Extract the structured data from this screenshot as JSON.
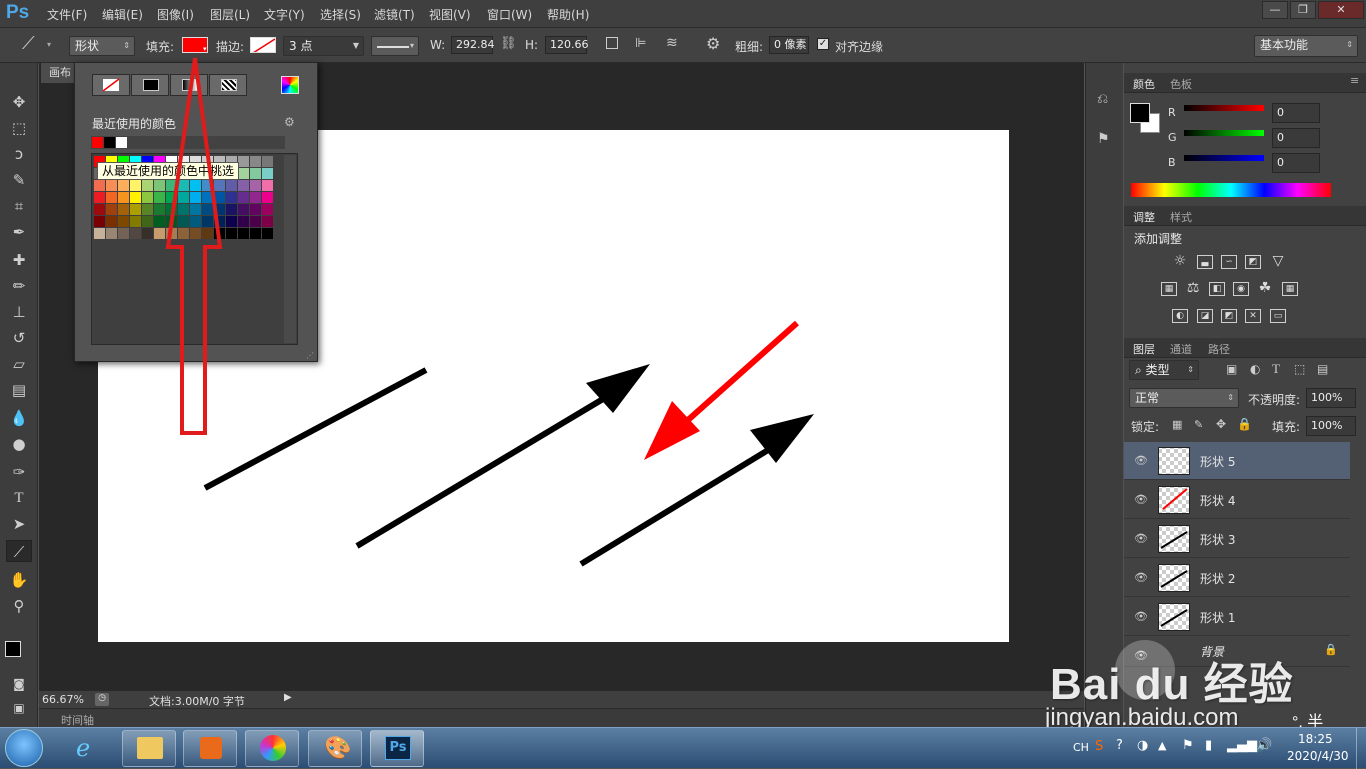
{
  "app": {
    "logo": "Ps"
  },
  "menu": [
    "文件(F)",
    "编辑(E)",
    "图像(I)",
    "图层(L)",
    "文字(Y)",
    "选择(S)",
    "滤镜(T)",
    "视图(V)",
    "窗口(W)",
    "帮助(H)"
  ],
  "window_controls": {
    "minimize": "—",
    "restore": "❐",
    "close": "✕"
  },
  "options": {
    "mode_value": "形状",
    "fill_label": "填充:",
    "fill_color": "#ff0000",
    "stroke_label": "描边:",
    "stroke_width": "3 点",
    "w_label": "W:",
    "w_value": "292.84",
    "h_label": "H:",
    "h_value": "120.66",
    "weight_label": "粗细:",
    "weight_value": "0 像素",
    "align_edges_label": "对齐边缘",
    "workspace": "基本功能"
  },
  "document": {
    "tab_label": "画布"
  },
  "status": {
    "zoom": "66.67%",
    "doc_info": "文档:3.00M/0 字节"
  },
  "timeline_label": "时间轴",
  "picker": {
    "recent_label": "最近使用的颜色",
    "recent_colors": [
      "#ff0000",
      "#000000",
      "#ffffff"
    ],
    "tooltip": "从最近使用的颜色中挑选"
  },
  "color_panel": {
    "tabs": [
      "颜色",
      "色板"
    ],
    "r_label": "R",
    "g_label": "G",
    "b_label": "B",
    "r_value": "0",
    "g_value": "0",
    "b_value": "0"
  },
  "adjust_panel": {
    "tabs": [
      "调整",
      "样式"
    ],
    "title": "添加调整"
  },
  "layers_panel": {
    "tabs": [
      "图层",
      "通道",
      "路径"
    ],
    "filter_label": "类型",
    "blend_mode": "正常",
    "opacity_label": "不透明度:",
    "opacity_value": "100%",
    "lock_label": "锁定:",
    "fill_label": "填充:",
    "fill_value": "100%",
    "layers": [
      {
        "name": "形状 5",
        "selected": true
      },
      {
        "name": "形状 4",
        "selected": false
      },
      {
        "name": "形状 3",
        "selected": false
      },
      {
        "name": "形状 2",
        "selected": false
      },
      {
        "name": "形状 1",
        "selected": false
      },
      {
        "name": "背景",
        "selected": false
      }
    ]
  },
  "taskbar": {
    "lang": "CH",
    "time": "18:25",
    "date": "2020/4/30",
    "ps_label": "Ps"
  },
  "watermark": {
    "brand": "Bai du 经验",
    "url": "jingyan.baidu.com",
    "ime": "°, 半"
  },
  "colors": {
    "accent_red": "#ff0000",
    "selected_layer": "#546074",
    "canvas": "#ffffff"
  }
}
